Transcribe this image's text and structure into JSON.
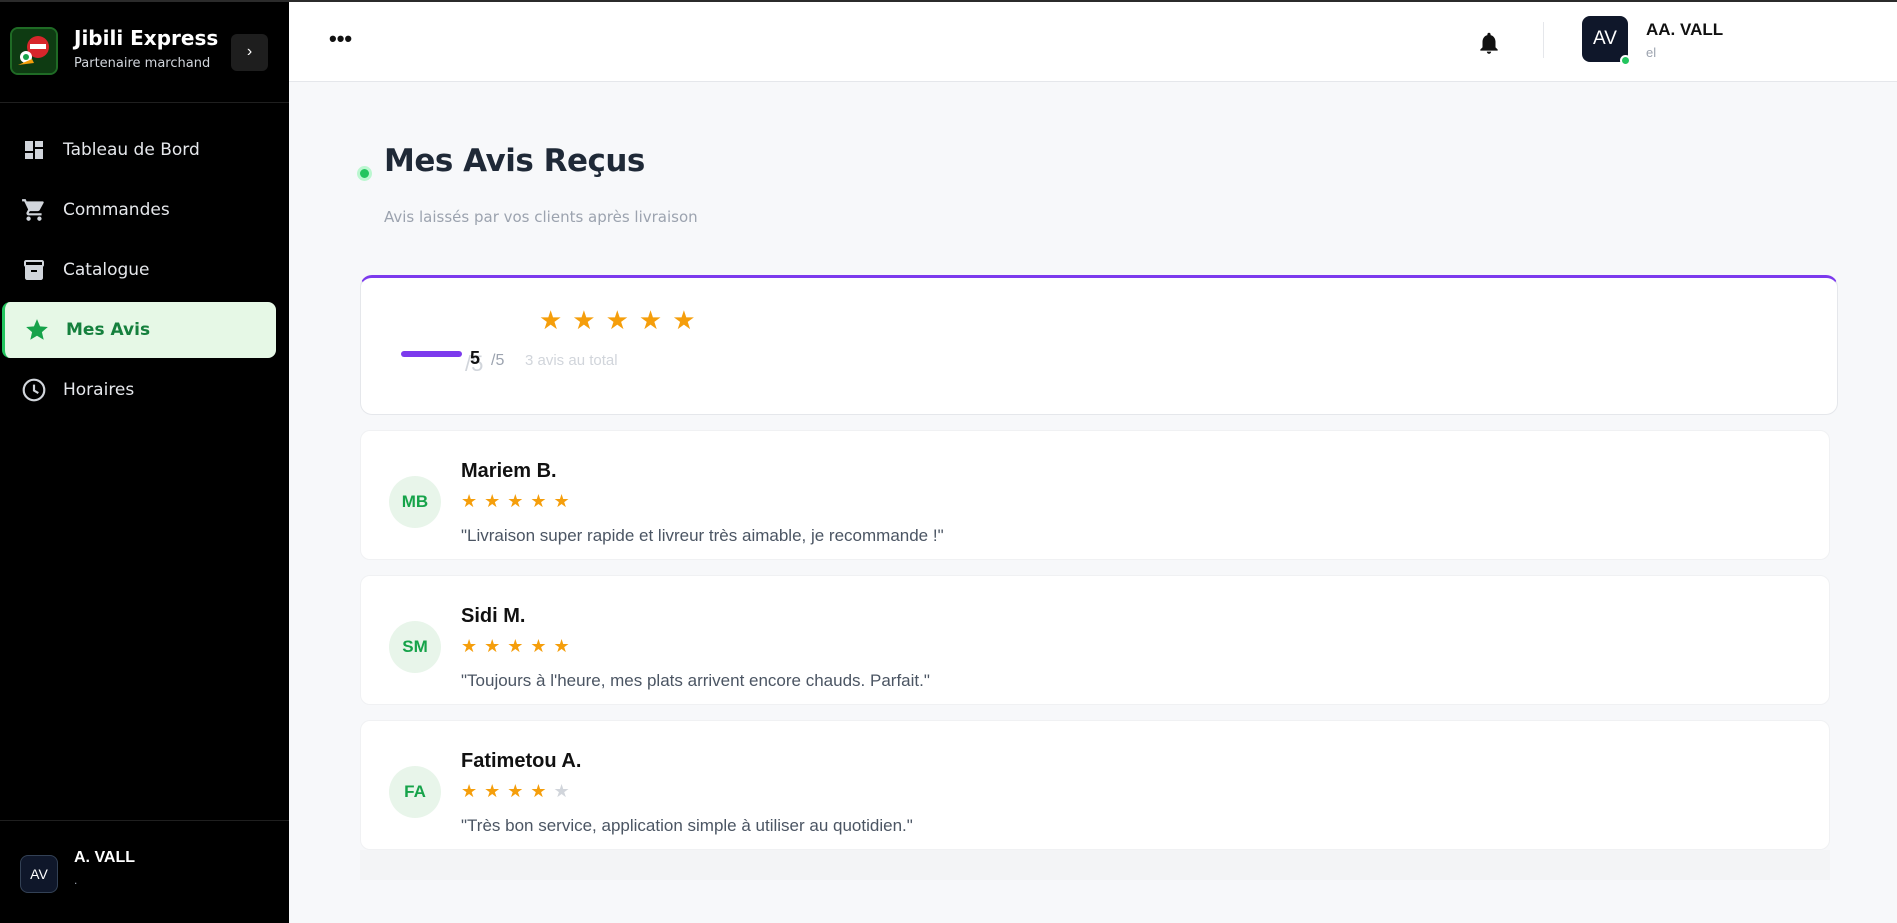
{
  "brand": {
    "title": "Jibili Express",
    "subtitle": "Partenaire marchand",
    "collapse_label": "›"
  },
  "sidebar": {
    "items": [
      {
        "label": "Tableau de Bord",
        "icon": "dashboard-icon",
        "active": false
      },
      {
        "label": "Commandes",
        "icon": "cart-icon",
        "active": false
      },
      {
        "label": "Catalogue",
        "icon": "archive-icon",
        "active": false
      },
      {
        "label": "Mes Avis",
        "icon": "star-icon",
        "active": true
      },
      {
        "label": "Horaires",
        "icon": "clock-icon",
        "active": false
      }
    ],
    "user": {
      "initials": "AV",
      "name": "A. VALL",
      "sub": "."
    }
  },
  "header": {
    "more_label": "•••",
    "bell_icon": "bell-icon",
    "user": {
      "initials": "AV",
      "name": "AA. VALL",
      "role": "el"
    }
  },
  "page": {
    "title": "Mes Avis Reçus",
    "subtitle": "Avis laissés par vos clients après livraison"
  },
  "summary": {
    "ghost": "/5",
    "score": "5",
    "max": "/5",
    "total": "3 avis au total",
    "stars": "★★★★★",
    "rating": 5
  },
  "reviews": [
    {
      "initials": "MB",
      "name": "Mariem B.",
      "rating": 5,
      "stars_on": "★★★★★",
      "stars_off": "",
      "text": "\"Livraison super rapide et livreur très aimable, je recommande !\""
    },
    {
      "initials": "SM",
      "name": "Sidi M.",
      "rating": 5,
      "stars_on": "★★★★★",
      "stars_off": "",
      "text": "\"Toujours à l'heure, mes plats arrivent encore chauds. Parfait.\""
    },
    {
      "initials": "FA",
      "name": "Fatimetou A.",
      "rating": 4,
      "stars_on": "★★★★",
      "stars_off": "★",
      "text": "\"Très bon service, application simple à utiliser au quotidien.\""
    }
  ],
  "colors": {
    "sidebar_bg": "#000000",
    "accent_green": "#22c55e",
    "accent_purple": "#7c3aed",
    "star": "#f59e0b"
  }
}
